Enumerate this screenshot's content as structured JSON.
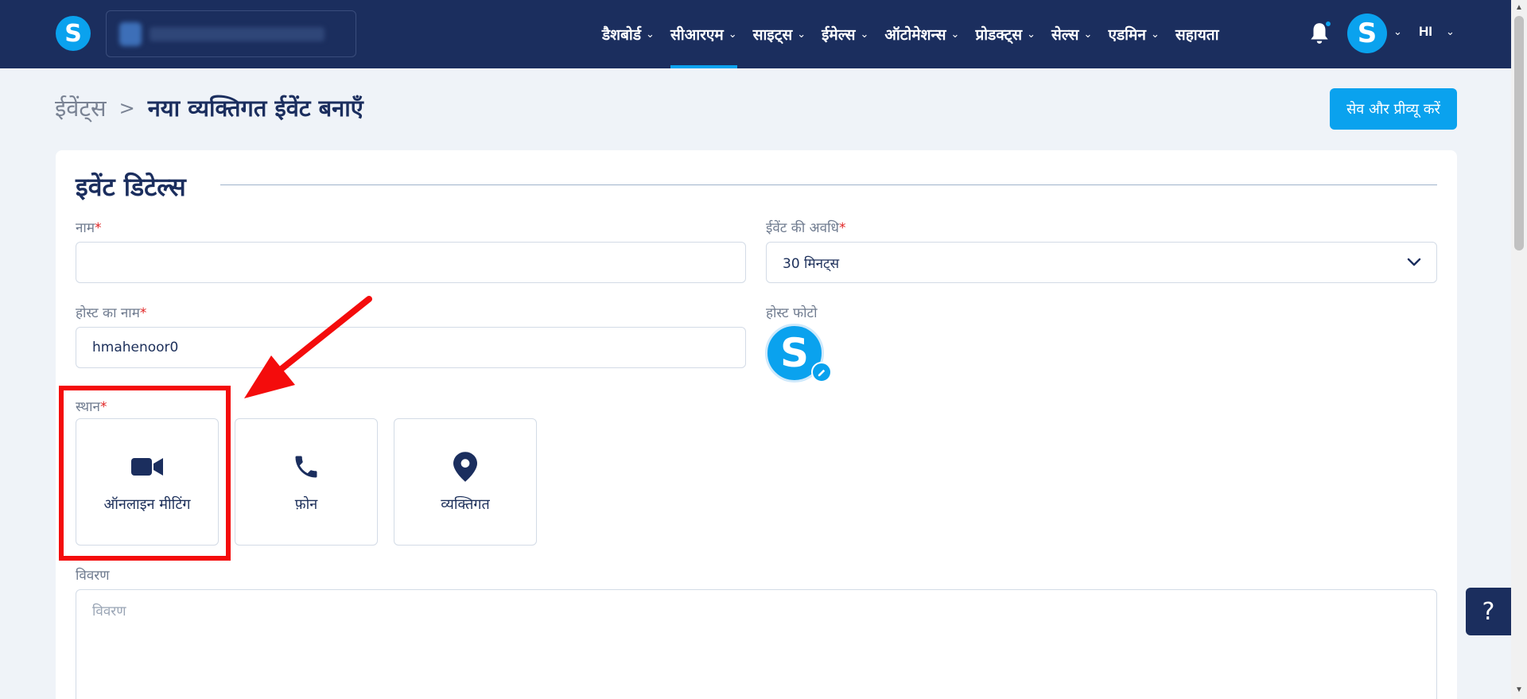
{
  "nav": {
    "items": [
      {
        "label": "डैशबोर्ड",
        "active": false
      },
      {
        "label": "सीआरएम",
        "active": true
      },
      {
        "label": "साइट्स",
        "active": false
      },
      {
        "label": "ईमेल्स",
        "active": false
      },
      {
        "label": "ऑटोमेशन्स",
        "active": false
      },
      {
        "label": "प्रोडक्ट्स",
        "active": false
      },
      {
        "label": "सेल्स",
        "active": false
      },
      {
        "label": "एडमिन",
        "active": false
      },
      {
        "label": "सहायता",
        "active": false
      }
    ],
    "logo_letter": "S",
    "avatar_letter": "S",
    "language": "HI"
  },
  "breadcrumb": {
    "parent": "ईवेंट्स",
    "separator": ">",
    "current": "नया व्यक्तिगत ईवेंट बनाएँ"
  },
  "actions": {
    "save_label": "सेव और प्रीव्यू करें"
  },
  "form": {
    "section_title": "इवेंट डिटेल्स",
    "name_label": "नाम",
    "name_value": "",
    "duration_label": "ईवेंट की अवधि",
    "duration_value": "30 मिनट्स",
    "host_name_label": "होस्ट का नाम",
    "host_name_value": "hmahenoor0",
    "host_photo_label": "होस्ट फोटो",
    "host_photo_letter": "S",
    "location_label": "स्थान",
    "required_mark": "*",
    "locations": [
      {
        "label": "ऑनलाइन मीटिंग",
        "icon": "video-camera-icon",
        "highlighted": true
      },
      {
        "label": "फ़ोन",
        "icon": "phone-icon",
        "highlighted": false
      },
      {
        "label": "व्यक्तिगत",
        "icon": "location-pin-icon",
        "highlighted": false
      }
    ],
    "description_label": "विवरण",
    "description_placeholder": "विवरण"
  },
  "help": {
    "label": "?"
  },
  "colors": {
    "navbar": "#1b2e5e",
    "accent": "#0aa2ee",
    "annotation": "#f40c0c"
  }
}
